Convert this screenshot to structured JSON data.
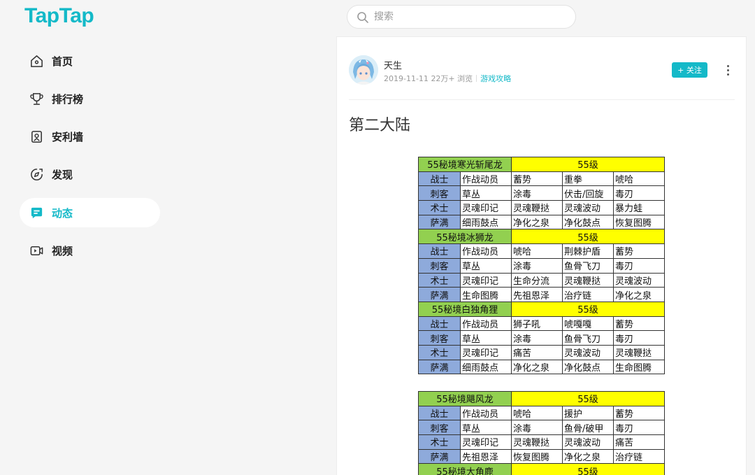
{
  "brand": {
    "logo_text": "TapTap",
    "accent": "#14b9c8"
  },
  "search": {
    "placeholder": "搜索",
    "value": ""
  },
  "sidebar": {
    "items": [
      {
        "label": "首页",
        "icon": "home-icon",
        "active": false
      },
      {
        "label": "排行榜",
        "icon": "trophy-icon",
        "active": false
      },
      {
        "label": "安利墙",
        "icon": "badge-icon",
        "active": false
      },
      {
        "label": "发现",
        "icon": "compass-icon",
        "active": false
      },
      {
        "label": "动态",
        "icon": "chat-icon",
        "active": true
      },
      {
        "label": "视频",
        "icon": "video-icon",
        "active": false
      }
    ]
  },
  "post": {
    "author": "天生",
    "date": "2019-11-11",
    "views": "22万+ 浏览",
    "tag": "游戏攻略",
    "follow_label": "+ 关注",
    "title": "第二大陆"
  },
  "tables": [
    {
      "sections": [
        {
          "name": "55秘境寒光斩尾龙",
          "level": "55级",
          "rows": [
            [
              "战士",
              "作战动员",
              "蓄势",
              "重拳",
              "唬哈"
            ],
            [
              "刺客",
              "草丛",
              "涂毒",
              "伏击/回旋",
              "毒刃"
            ],
            [
              "术士",
              "灵魂印记",
              "灵魂鞭挞",
              "灵魂波动",
              "暴力蛙"
            ],
            [
              "萨满",
              "细雨鼓点",
              "净化之泉",
              "净化鼓点",
              "恢复图腾"
            ]
          ]
        },
        {
          "name": "55秘境冰狮龙",
          "level": "55级",
          "rows": [
            [
              "战士",
              "作战动员",
              "唬哈",
              "荆棘护盾",
              "蓄势"
            ],
            [
              "刺客",
              "草丛",
              "涂毒",
              "鱼骨飞刀",
              "毒刃"
            ],
            [
              "术士",
              "灵魂印记",
              "生命分流",
              "灵魂鞭挞",
              "灵魂波动"
            ],
            [
              "萨满",
              "生命图腾",
              "先祖恩泽",
              "治疗链",
              "净化之泉"
            ]
          ]
        },
        {
          "name": "55秘境白独角狸",
          "level": "55级",
          "rows": [
            [
              "战士",
              "作战动员",
              "狮子吼",
              "唬嘎嘎",
              "蓄势"
            ],
            [
              "刺客",
              "草丛",
              "涂毒",
              "鱼骨飞刀",
              "毒刃"
            ],
            [
              "术士",
              "灵魂印记",
              "痛苦",
              "灵魂波动",
              "灵魂鞭挞"
            ],
            [
              "萨满",
              "细雨鼓点",
              "净化之泉",
              "净化鼓点",
              "生命图腾"
            ]
          ]
        }
      ]
    },
    {
      "sections": [
        {
          "name": "55秘境飓风龙",
          "level": "55级",
          "rows": [
            [
              "战士",
              "作战动员",
              "唬哈",
              "援护",
              "蓄势"
            ],
            [
              "刺客",
              "草丛",
              "涂毒",
              "鱼骨/破甲",
              "毒刃"
            ],
            [
              "术士",
              "灵魂印记",
              "灵魂鞭挞",
              "灵魂波动",
              "痛苦"
            ],
            [
              "萨满",
              "先祖恩泽",
              "恢复图腾",
              "净化之泉",
              "治疗链"
            ]
          ]
        },
        {
          "name": "55秘境大角鹿",
          "level": "55级",
          "rows": []
        }
      ]
    }
  ]
}
